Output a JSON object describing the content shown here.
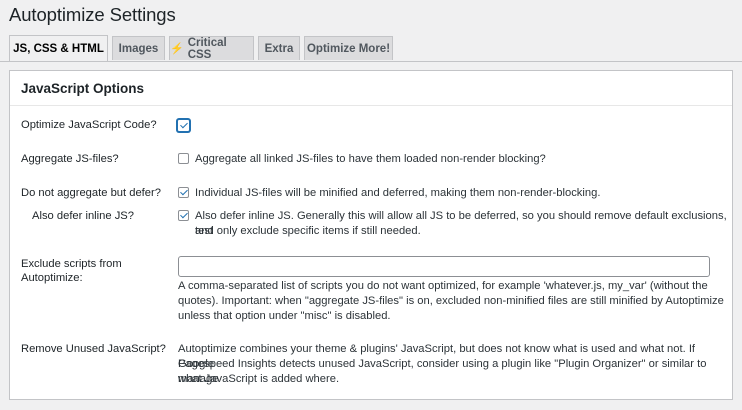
{
  "page": {
    "title": "Autoptimize Settings"
  },
  "tabs": [
    {
      "label": "JS, CSS & HTML",
      "active": true
    },
    {
      "label": "Images",
      "active": false
    },
    {
      "label": "Critical CSS",
      "icon": "lightning-bolt-icon",
      "active": false
    },
    {
      "label": "Extra",
      "active": false
    },
    {
      "label": "Optimize More!",
      "active": false
    }
  ],
  "section": {
    "title": "JavaScript Options"
  },
  "rows": {
    "optimize_js": {
      "label": "Optimize JavaScript Code?",
      "checked": true
    },
    "aggregate_js": {
      "label": "Aggregate JS-files?",
      "checked": false,
      "desc": "Aggregate all linked JS-files to have them loaded non-render blocking?"
    },
    "defer": {
      "label": "Do not aggregate but defer?",
      "checked": true,
      "desc": "Individual JS-files will be minified and deferred, making them non-render-blocking."
    },
    "defer_inline": {
      "label": "Also defer inline JS?",
      "checked": true,
      "desc_line1": "Also defer inline JS. Generally this will allow all JS to be deferred, so you should remove default exclusions, test",
      "desc_line2": "and only exclude specific items if still needed."
    },
    "exclude": {
      "label_line1": "Exclude scripts from",
      "label_line2": "Autoptimize:",
      "value": "",
      "desc_line1": "A comma-separated list of scripts you do not want optimized, for example 'whatever.js, my_var' (without the",
      "desc_line2": "quotes). Important: when \"aggregate JS-files\" is on, excluded non-minified files are still minified by Autoptimize",
      "desc_line3": "unless that option under \"misc\" is disabled."
    },
    "unused": {
      "label": "Remove Unused JavaScript?",
      "desc_line1": "Autoptimize combines your theme & plugins' JavaScript, but does not know what is used and what not. If Google",
      "desc_line2": "Pagespeed Insights detects unused JavaScript, consider using a plugin like \"Plugin Organizer\" or similar to manage",
      "desc_line3": "what JavaScript is added where."
    }
  },
  "colors": {
    "accent": "#2271b1",
    "bolt": "#dba617",
    "tab_bg": "#dcdcde",
    "page_bg": "#f0f0f1"
  }
}
